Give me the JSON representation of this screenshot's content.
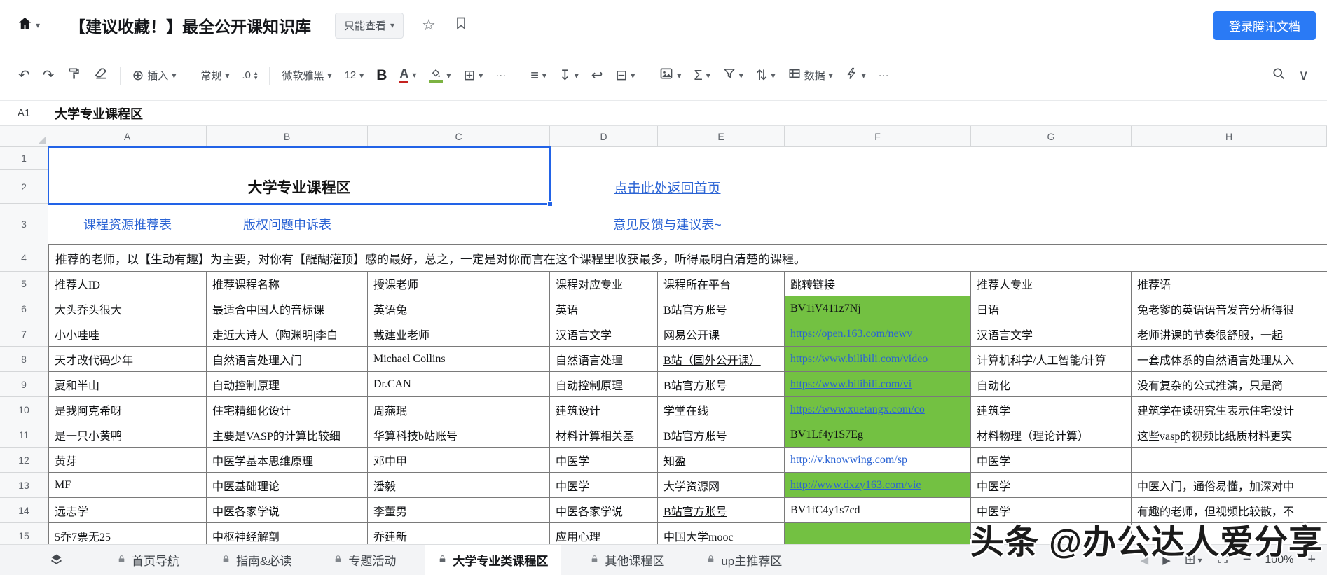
{
  "topbar": {
    "title": "【建议收藏！】最全公开课知识库",
    "view_only": "只能查看",
    "login": "登录腾讯文档"
  },
  "toolbar": {
    "insert_label": "插入",
    "format_label": "常规",
    "decimal_label": ".0",
    "font_family": "微软雅黑",
    "font_size": "12",
    "data_label": "数据"
  },
  "formula": {
    "cell_ref": "A1",
    "content": "大学专业课程区"
  },
  "icons": {
    "undo": "↶",
    "redo": "↷",
    "insert_plus": "⊕",
    "caret": "▾",
    "tri_up": "▴",
    "tri_down": "▾",
    "bold": "B",
    "font_color": "A",
    "borders": "⊞",
    "more": "···",
    "align": "≡",
    "valign": "↧",
    "wrap": "↩",
    "merge": "⊟",
    "sum": "Σ",
    "sort": "⇅",
    "collapse": "∨",
    "star": "☆",
    "prev": "◀",
    "next": "▶",
    "minus": "−",
    "zoom_plus": "+",
    "grid": "⊞"
  },
  "grid": {
    "col_letters": [
      "A",
      "B",
      "C",
      "D",
      "E",
      "F",
      "G",
      "H"
    ],
    "row_nums": [
      "1",
      "2",
      "3",
      "4",
      "5",
      "6",
      "7",
      "8",
      "9",
      "10",
      "11",
      "12",
      "13",
      "14",
      "15"
    ],
    "title": "大学专业课程区",
    "home_link": "点击此处返回首页",
    "links": {
      "course": "课程资源推荐表",
      "copyright": "版权问题申诉表",
      "feedback": "意见反馈与建议表~"
    },
    "note": "推荐的老师，以【生动有趣】为主要，对你有【醍醐灌顶】感的最好，总之，一定是对你而言在这个课程里收获最多，听得最明白清楚的课程。",
    "table": {
      "headers": [
        "推荐人ID",
        "推荐课程名称",
        "授课老师",
        "课程对应专业",
        "课程所在平台",
        "跳转链接",
        "推荐人专业",
        "推荐语"
      ],
      "rows": [
        {
          "id": "大头乔头很大",
          "course": "最适合中国人的音标课",
          "teacher": "英语兔",
          "major": "英语",
          "platform": "B站官方账号",
          "link": "BV1iV411z7Nj",
          "rec_major": "日语",
          "comment": "兔老爹的英语语音发音分析得很"
        },
        {
          "id": "小小哇哇",
          "course": "走近大诗人（陶渊明|李白",
          "teacher": "戴建业老师",
          "major": "汉语言文学",
          "platform": "网易公开课",
          "link": "https://open.163.com/newv",
          "rec_major": "汉语言文学",
          "comment": "老师讲课的节奏很舒服，一起"
        },
        {
          "id": "天才改代码少年",
          "course": "自然语言处理入门",
          "teacher": "Michael Collins",
          "major": "自然语言处理",
          "platform": "B站（国外公开课）",
          "link": "https://www.bilibili.com/video",
          "rec_major": "计算机科学/人工智能/计算",
          "comment": "一套成体系的自然语言处理从入"
        },
        {
          "id": "夏和半山",
          "course": "自动控制原理",
          "teacher": "Dr.CAN",
          "major": "自动控制原理",
          "platform": "B站官方账号",
          "link": "https://www.bilibili.com/vi",
          "rec_major": "自动化",
          "comment": "没有复杂的公式推演，只是简"
        },
        {
          "id": "是我阿克希呀",
          "course": "住宅精细化设计",
          "teacher": "周燕珉",
          "major": "建筑设计",
          "platform": "学堂在线",
          "link": "https://www.xuetangx.com/co",
          "rec_major": "建筑学",
          "comment": "建筑学在读研究生表示住宅设计"
        },
        {
          "id": "是一只小黄鸭",
          "course": "主要是VASP的计算比较细",
          "teacher": "华算科技b站账号",
          "major": "材料计算相关基",
          "platform": "B站官方账号",
          "link": "BV1Lf4y1S7Eg",
          "rec_major": "材料物理（理论计算）",
          "comment": "这些vasp的视频比纸质材料更实"
        },
        {
          "id": "黄芽",
          "course": "中医学基本思维原理",
          "teacher": "邓中甲",
          "major": "中医学",
          "platform": "知盈",
          "link": "http://v.knowwing.com/sp",
          "rec_major": "中医学",
          "comment": ""
        },
        {
          "id": "MF",
          "course": "中医基础理论",
          "teacher": "潘毅",
          "major": "中医学",
          "platform": "大学资源网",
          "link": "http://www.dxzy163.com/vie",
          "rec_major": "中医学",
          "comment": "中医入门，通俗易懂，加深对中"
        },
        {
          "id": "远志学",
          "course": "中医各家学说",
          "teacher": "李董男",
          "major": "中医各家学说",
          "platform": "B站官方账号",
          "link": "BV1fC4y1s7cd",
          "rec_major": "中医学",
          "comment": "有趣的老师，但视频比较散，不"
        },
        {
          "id": "5乔7票无25",
          "course": "中枢神经解剖",
          "teacher": "乔建新",
          "major": "应用心理",
          "platform": "中国大学mooc",
          "link": "",
          "rec_major": "",
          "comment": ""
        }
      ]
    }
  },
  "sheetbar": {
    "tabs": [
      {
        "label": "首页导航"
      },
      {
        "label": "指南&必读"
      },
      {
        "label": "专题活动"
      },
      {
        "label": "大学专业类课程区"
      },
      {
        "label": "其他课程区"
      },
      {
        "label": "up主推荐区"
      }
    ],
    "active_tab": "大学专业类课程区",
    "zoom": "100%"
  },
  "watermark": {
    "text": "头条 @办公达人爱分享"
  },
  "colors": {
    "accent": "#2a7af5",
    "selection": "#2263e7",
    "green": "#73c142",
    "link": "#2a63d4"
  }
}
